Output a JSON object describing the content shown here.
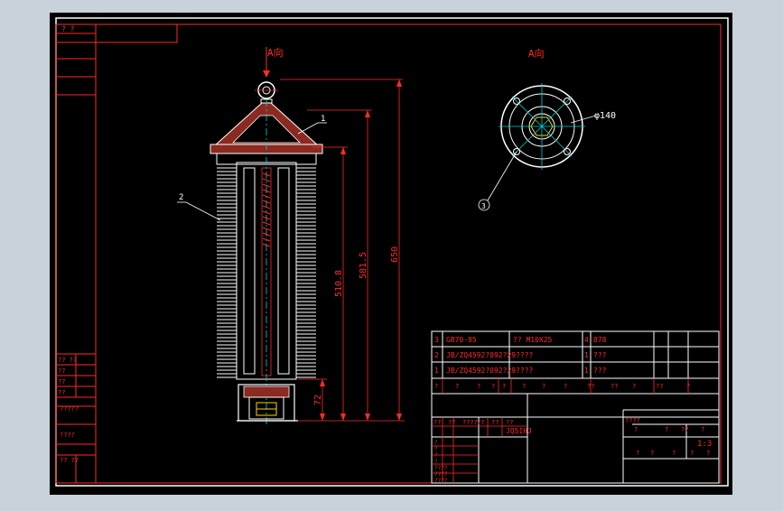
{
  "colors": {
    "background_outer": "#c9d1db",
    "canvas": "#000000",
    "frame": "#ffffff",
    "border_red": "#ff2a2a",
    "cad_white": "#ffffff",
    "cad_red": "#ff2a2a",
    "cad_brown": "#8b2a20",
    "cad_cyan": "#00d0d0",
    "cad_yellow": "#ffd000"
  },
  "view_labels": {
    "front_view_arrow": "A向",
    "side_view_title": "A向"
  },
  "leaders": {
    "part1": "1",
    "part2": "2",
    "part3": "3"
  },
  "dimensions": {
    "overall": "650",
    "upper": "581.5",
    "body": "510.8",
    "base": "72",
    "flange_dia": "φ140"
  },
  "left_strip_text": {
    "top_cell": "?  ?",
    "mid_cell_a": "??  ??",
    "mid_cell_b": "??",
    "mid_cell_c": "??",
    "mid_cell_d": "??",
    "low_cell_1": "?????",
    "low_cell_2": "????",
    "bottom_cell": "??  ??"
  },
  "parts_list": [
    {
      "no": "3",
      "code": "GB70-85",
      "name": "?? M10X25",
      "qty": "4",
      "material": "878"
    },
    {
      "no": "2",
      "code": "JB/ZQ4592?092?29????",
      "name": "",
      "qty": "1",
      "material": "???"
    },
    {
      "no": "1",
      "code": "JB/ZQ4592?092?29????",
      "name": "",
      "qty": "1",
      "material": "???"
    }
  ],
  "title_block": {
    "header_row": [
      "?",
      "?",
      "?",
      "?",
      "?",
      "?",
      "?",
      "?",
      "??",
      "??",
      "?",
      "??",
      "?"
    ],
    "sign_labels": [
      "??",
      "??",
      "????",
      "??",
      "??",
      "??"
    ],
    "standard_code": "JQ5IHJ",
    "row_labels": [
      "?",
      "?",
      "?",
      "?",
      "????",
      "????",
      "????"
    ],
    "stage_labels": [
      "????",
      "?",
      "?",
      "??",
      "?"
    ],
    "scale": "1:3",
    "footer": [
      "?",
      "?",
      "?",
      "?",
      "?"
    ]
  }
}
